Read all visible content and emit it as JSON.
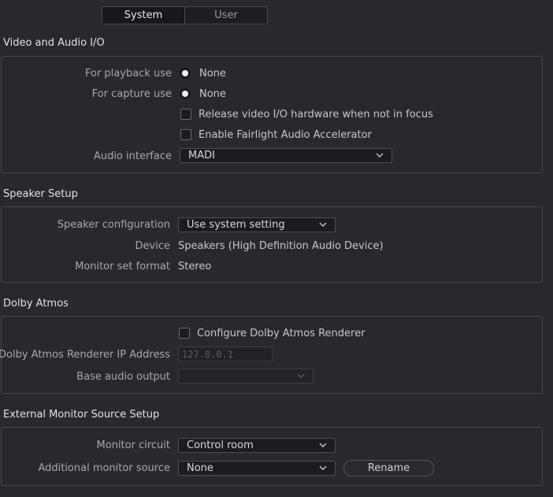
{
  "tabs": [
    {
      "label": "System",
      "active": true
    },
    {
      "label": "User",
      "active": false
    }
  ],
  "video_audio_io": {
    "title": "Video and Audio I/O",
    "playback_label": "For playback use",
    "playback_value": "None",
    "capture_label": "For capture use",
    "capture_value": "None",
    "release_label": "Release video I/O hardware when not in focus",
    "release_checked": false,
    "fairlight_label": "Enable Fairlight Audio Accelerator",
    "fairlight_checked": false,
    "audio_interface_label": "Audio interface",
    "audio_interface_value": "MADI"
  },
  "speaker_setup": {
    "title": "Speaker Setup",
    "config_label": "Speaker configuration",
    "config_value": "Use system setting",
    "device_label": "Device",
    "device_value": "Speakers (High Definition Audio Device)",
    "monitor_format_label": "Monitor set format",
    "monitor_format_value": "Stereo"
  },
  "dolby_atmos": {
    "title": "Dolby Atmos",
    "configure_label": "Configure Dolby Atmos Renderer",
    "configure_checked": false,
    "ip_label": "Dolby Atmos Renderer IP Address",
    "ip_value": "127.0.0.1",
    "base_output_label": "Base audio output",
    "base_output_value": ""
  },
  "external_monitor": {
    "title": "External Monitor Source Setup",
    "circuit_label": "Monitor circuit",
    "circuit_value": "Control room",
    "additional_label": "Additional monitor source",
    "additional_value": "None",
    "rename_label": "Rename"
  },
  "colors": {
    "background": "#28282e",
    "panel_border": "#4a4a50",
    "label": "#a9a9a9",
    "text": "#d0d0d0"
  }
}
